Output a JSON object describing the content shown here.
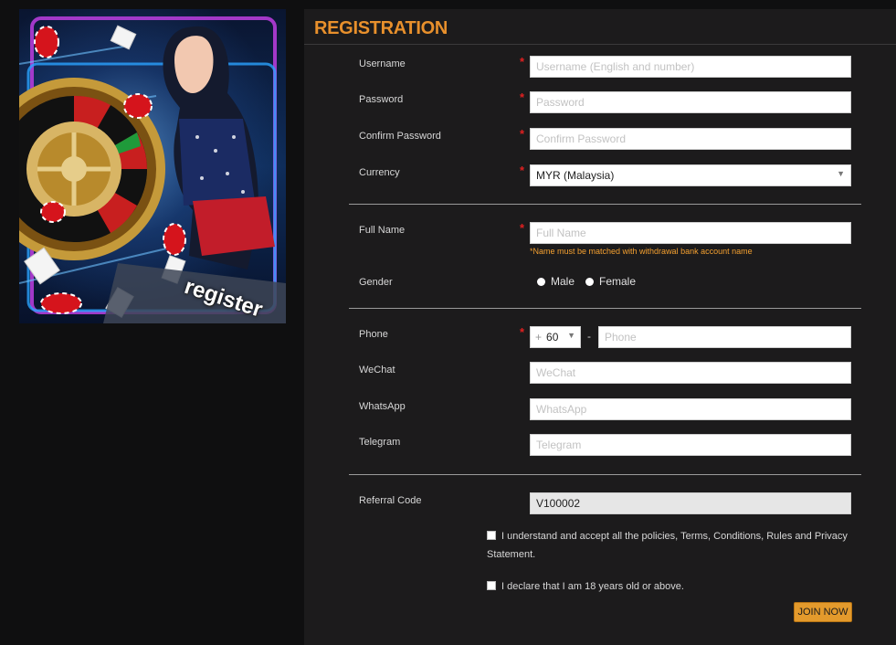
{
  "banner": {
    "text": "register"
  },
  "form": {
    "title": "REGISTRATION",
    "username": {
      "label": "Username",
      "placeholder": "Username (English and number)"
    },
    "password": {
      "label": "Password",
      "placeholder": "Password"
    },
    "confirm_password": {
      "label": "Confirm Password",
      "placeholder": "Confirm Password"
    },
    "currency": {
      "label": "Currency",
      "value": "MYR (Malaysia)"
    },
    "full_name": {
      "label": "Full Name",
      "placeholder": "Full Name",
      "hint": "*Name must be matched with withdrawal bank account name"
    },
    "gender": {
      "label": "Gender",
      "options": [
        "Male",
        "Female"
      ]
    },
    "phone": {
      "label": "Phone",
      "prefix_sign": "+",
      "country_code": "60",
      "separator": "-",
      "placeholder": "Phone"
    },
    "wechat": {
      "label": "WeChat",
      "placeholder": "WeChat"
    },
    "whatsapp": {
      "label": "WhatsApp",
      "placeholder": "WhatsApp"
    },
    "telegram": {
      "label": "Telegram",
      "placeholder": "Telegram"
    },
    "referral": {
      "label": "Referral Code",
      "value": "V100002"
    },
    "agree_terms": "I understand and accept all the policies, Terms, Conditions, Rules and Privacy Statement.",
    "agree_age": "I declare that I am 18 years old or above.",
    "submit_label": "JOIN NOW",
    "required_mark": "*"
  },
  "colors": {
    "accent": "#e8902c",
    "button": "#e39a2c",
    "required": "#e02020",
    "hint": "#f4a030",
    "panel": "#1c1b1c"
  }
}
